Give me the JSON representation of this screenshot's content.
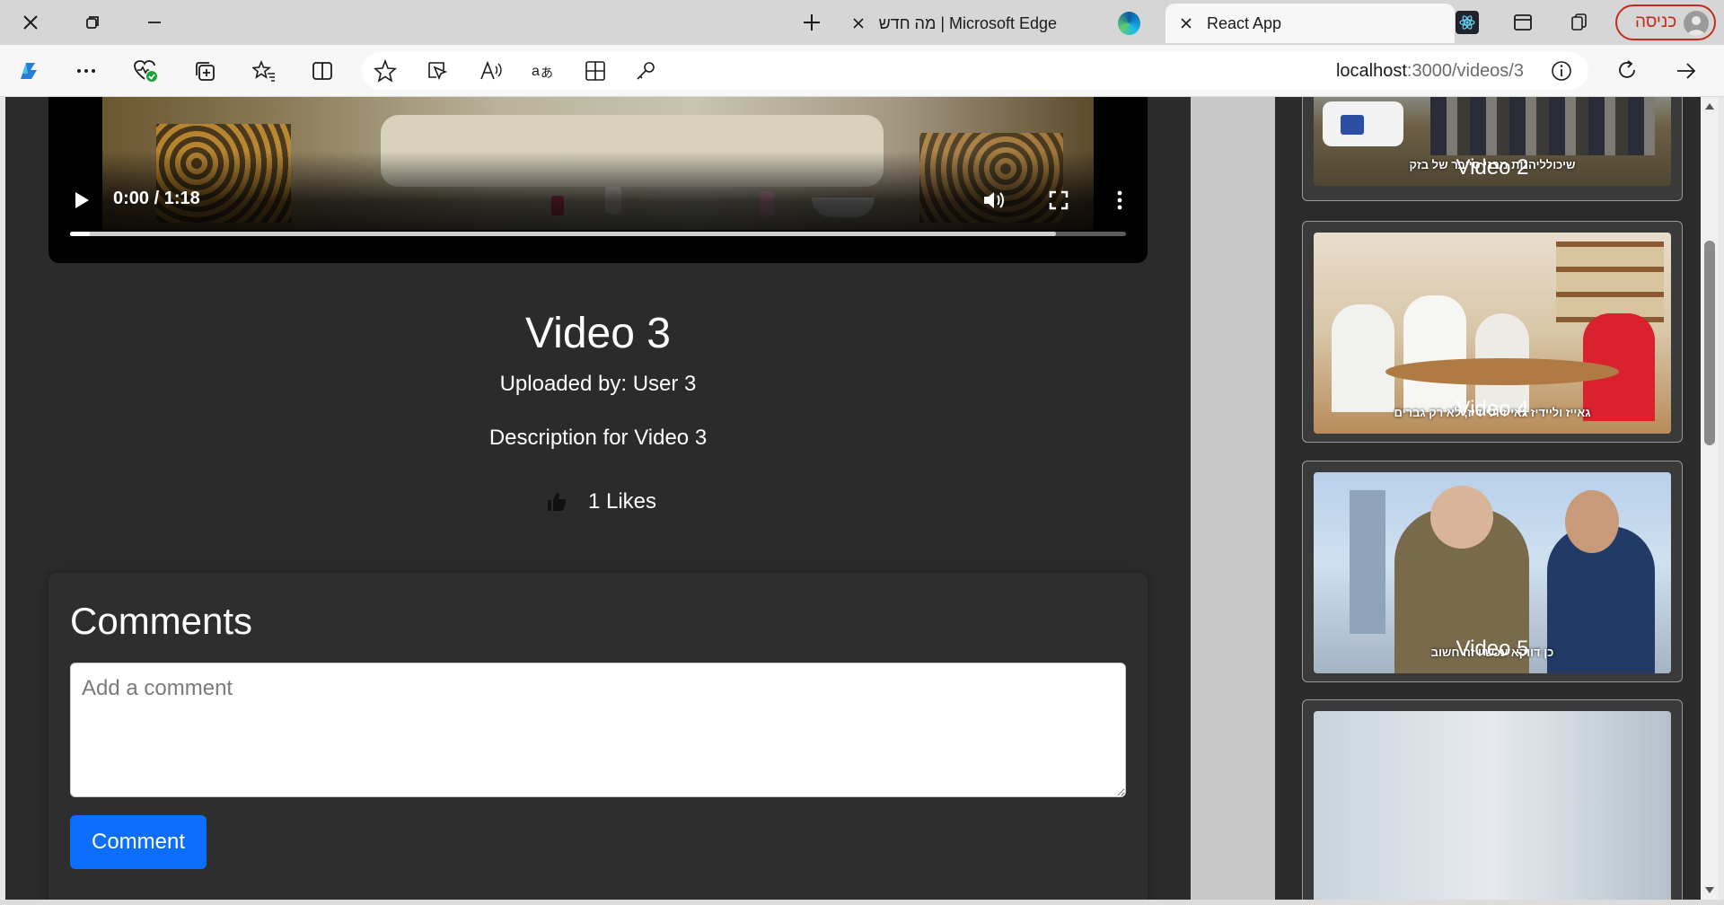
{
  "window": {
    "tabs": [
      {
        "label": "מה חדש | Microsoft Edge",
        "active": false
      },
      {
        "label": "React App",
        "active": true
      }
    ],
    "profile_label": "כניסה"
  },
  "toolbar": {
    "url_host": "localhost",
    "url_path": ":3000/videos/3"
  },
  "player": {
    "time_display": "0:00 / 1:18",
    "progress_played": 0,
    "progress_buffered": 0.934
  },
  "video": {
    "title": "Video 3",
    "uploader": "Uploaded by: User 3",
    "description": "Description for Video 3",
    "likes_text": "1 Likes"
  },
  "comments": {
    "heading": "Comments",
    "placeholder": "Add a comment",
    "button_label": "Comment"
  },
  "sidebar": {
    "videos": [
      {
        "title": "Video 2",
        "caption": "שיכולליהנות מבני סייבר של בזק"
      },
      {
        "title": "Video 4",
        "caption": "גאייז וליידיז גאייז וליידיז, לא רק גברים"
      },
      {
        "title": "Video 5",
        "caption": "כן דווקא עכשיו זה חשוב"
      }
    ]
  },
  "colors": {
    "page_bg": "#2b2b2b",
    "accent_button": "#0d6efd",
    "profile_red": "#c42b1c"
  }
}
